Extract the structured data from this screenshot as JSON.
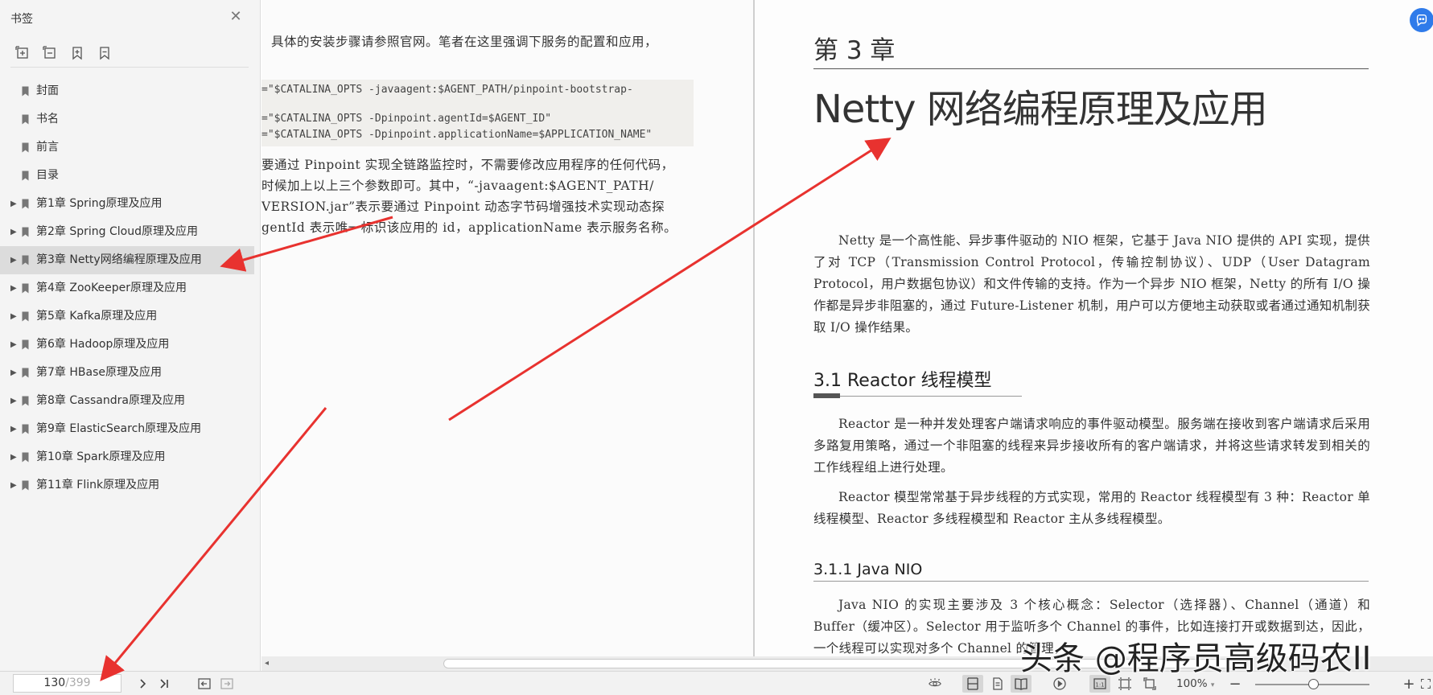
{
  "sidebar": {
    "title": "书签",
    "items": [
      {
        "label": "封面",
        "expandable": false
      },
      {
        "label": "书名",
        "expandable": false
      },
      {
        "label": "前言",
        "expandable": false
      },
      {
        "label": "目录",
        "expandable": false
      },
      {
        "label": "第1章 Spring原理及应用",
        "expandable": true
      },
      {
        "label": "第2章 Spring Cloud原理及应用",
        "expandable": true
      },
      {
        "label": "第3章 Netty网络编程原理及应用",
        "expandable": true,
        "active": true
      },
      {
        "label": "第4章 ZooKeeper原理及应用",
        "expandable": true
      },
      {
        "label": "第5章 Kafka原理及应用",
        "expandable": true
      },
      {
        "label": "第6章 Hadoop原理及应用",
        "expandable": true
      },
      {
        "label": "第7章 HBase原理及应用",
        "expandable": true
      },
      {
        "label": "第8章 Cassandra原理及应用",
        "expandable": true
      },
      {
        "label": "第9章 ElasticSearch原理及应用",
        "expandable": true
      },
      {
        "label": "第10章 Spark原理及应用",
        "expandable": true
      },
      {
        "label": "第11章 Flink原理及应用",
        "expandable": true
      }
    ]
  },
  "left_page": {
    "line1": "具体的安装步骤请参照官网。笔者在这里强调下服务的配置和应用，",
    "code": [
      "=\"$CATALINA_OPTS -javaagent:$AGENT_PATH/pinpoint-bootstrap-",
      "=\"$CATALINA_OPTS -Dpinpoint.agentId=$AGENT_ID\"",
      "=\"$CATALINA_OPTS -Dpinpoint.applicationName=$APPLICATION_NAME\""
    ],
    "body": [
      "要通过 Pinpoint 实现全链路监控时，不需要修改应用程序的任何代码，",
      "时候加上以上三个参数即可。其中，“-javaagent:$AGENT_PATH/",
      "VERSION.jar”表示要通过 Pinpoint 动态字节码增强技术实现动态探",
      "gentId 表示唯一标识该应用的 id，applicationName 表示服务名称。"
    ]
  },
  "right_page": {
    "chapter": "第 3 章",
    "title": "Netty 网络编程原理及应用",
    "intro": "Netty 是一个高性能、异步事件驱动的 NIO 框架，它基于 Java NIO 提供的 API 实现，提供了对 TCP（Transmission Control Protocol，传输控制协议）、UDP（User Datagram Protocol，用户数据包协议）和文件传输的支持。作为一个异步 NIO 框架，Netty 的所有 I/O 操作都是异步非阻塞的，通过 Future-Listener 机制，用户可以方便地主动获取或者通过通知机制获取 I/O 操作结果。",
    "sec1_title": "3.1    Reactor 线程模型",
    "sec1_p1": "Reactor 是一种并发处理客户端请求响应的事件驱动模型。服务端在接收到客户端请求后采用多路复用策略，通过一个非阻塞的线程来异步接收所有的客户端请求，并将这些请求转发到相关的工作线程组上进行处理。",
    "sec1_p2": "Reactor 模型常常基于异步线程的方式实现，常用的 Reactor 线程模型有 3 种：Reactor 单线程模型、Reactor 多线程模型和 Reactor 主从多线程模型。",
    "sec11_title": "3.1.1    Java NIO",
    "sec11_p1": "Java NIO 的实现主要涉及 3 个核心概念：Selector（选择器）、Channel（通道）和 Buffer（缓冲区）。Selector 用于监听多个 Channel 的事件，比如连接打开或数据到达，因此，一个线程可以实现对多个 Channel 的管理，"
  },
  "status": {
    "current_page": "130",
    "total_pages": "/399",
    "zoom": "100%",
    "zoom_level": 0.51
  },
  "watermark": "头条 @程序员高级码农II",
  "colors": {
    "arrow": "#e8322f",
    "active_item": "#dcdcdc",
    "sidebar_bg": "#f4f4f4",
    "assistant": "#2f7bea"
  }
}
